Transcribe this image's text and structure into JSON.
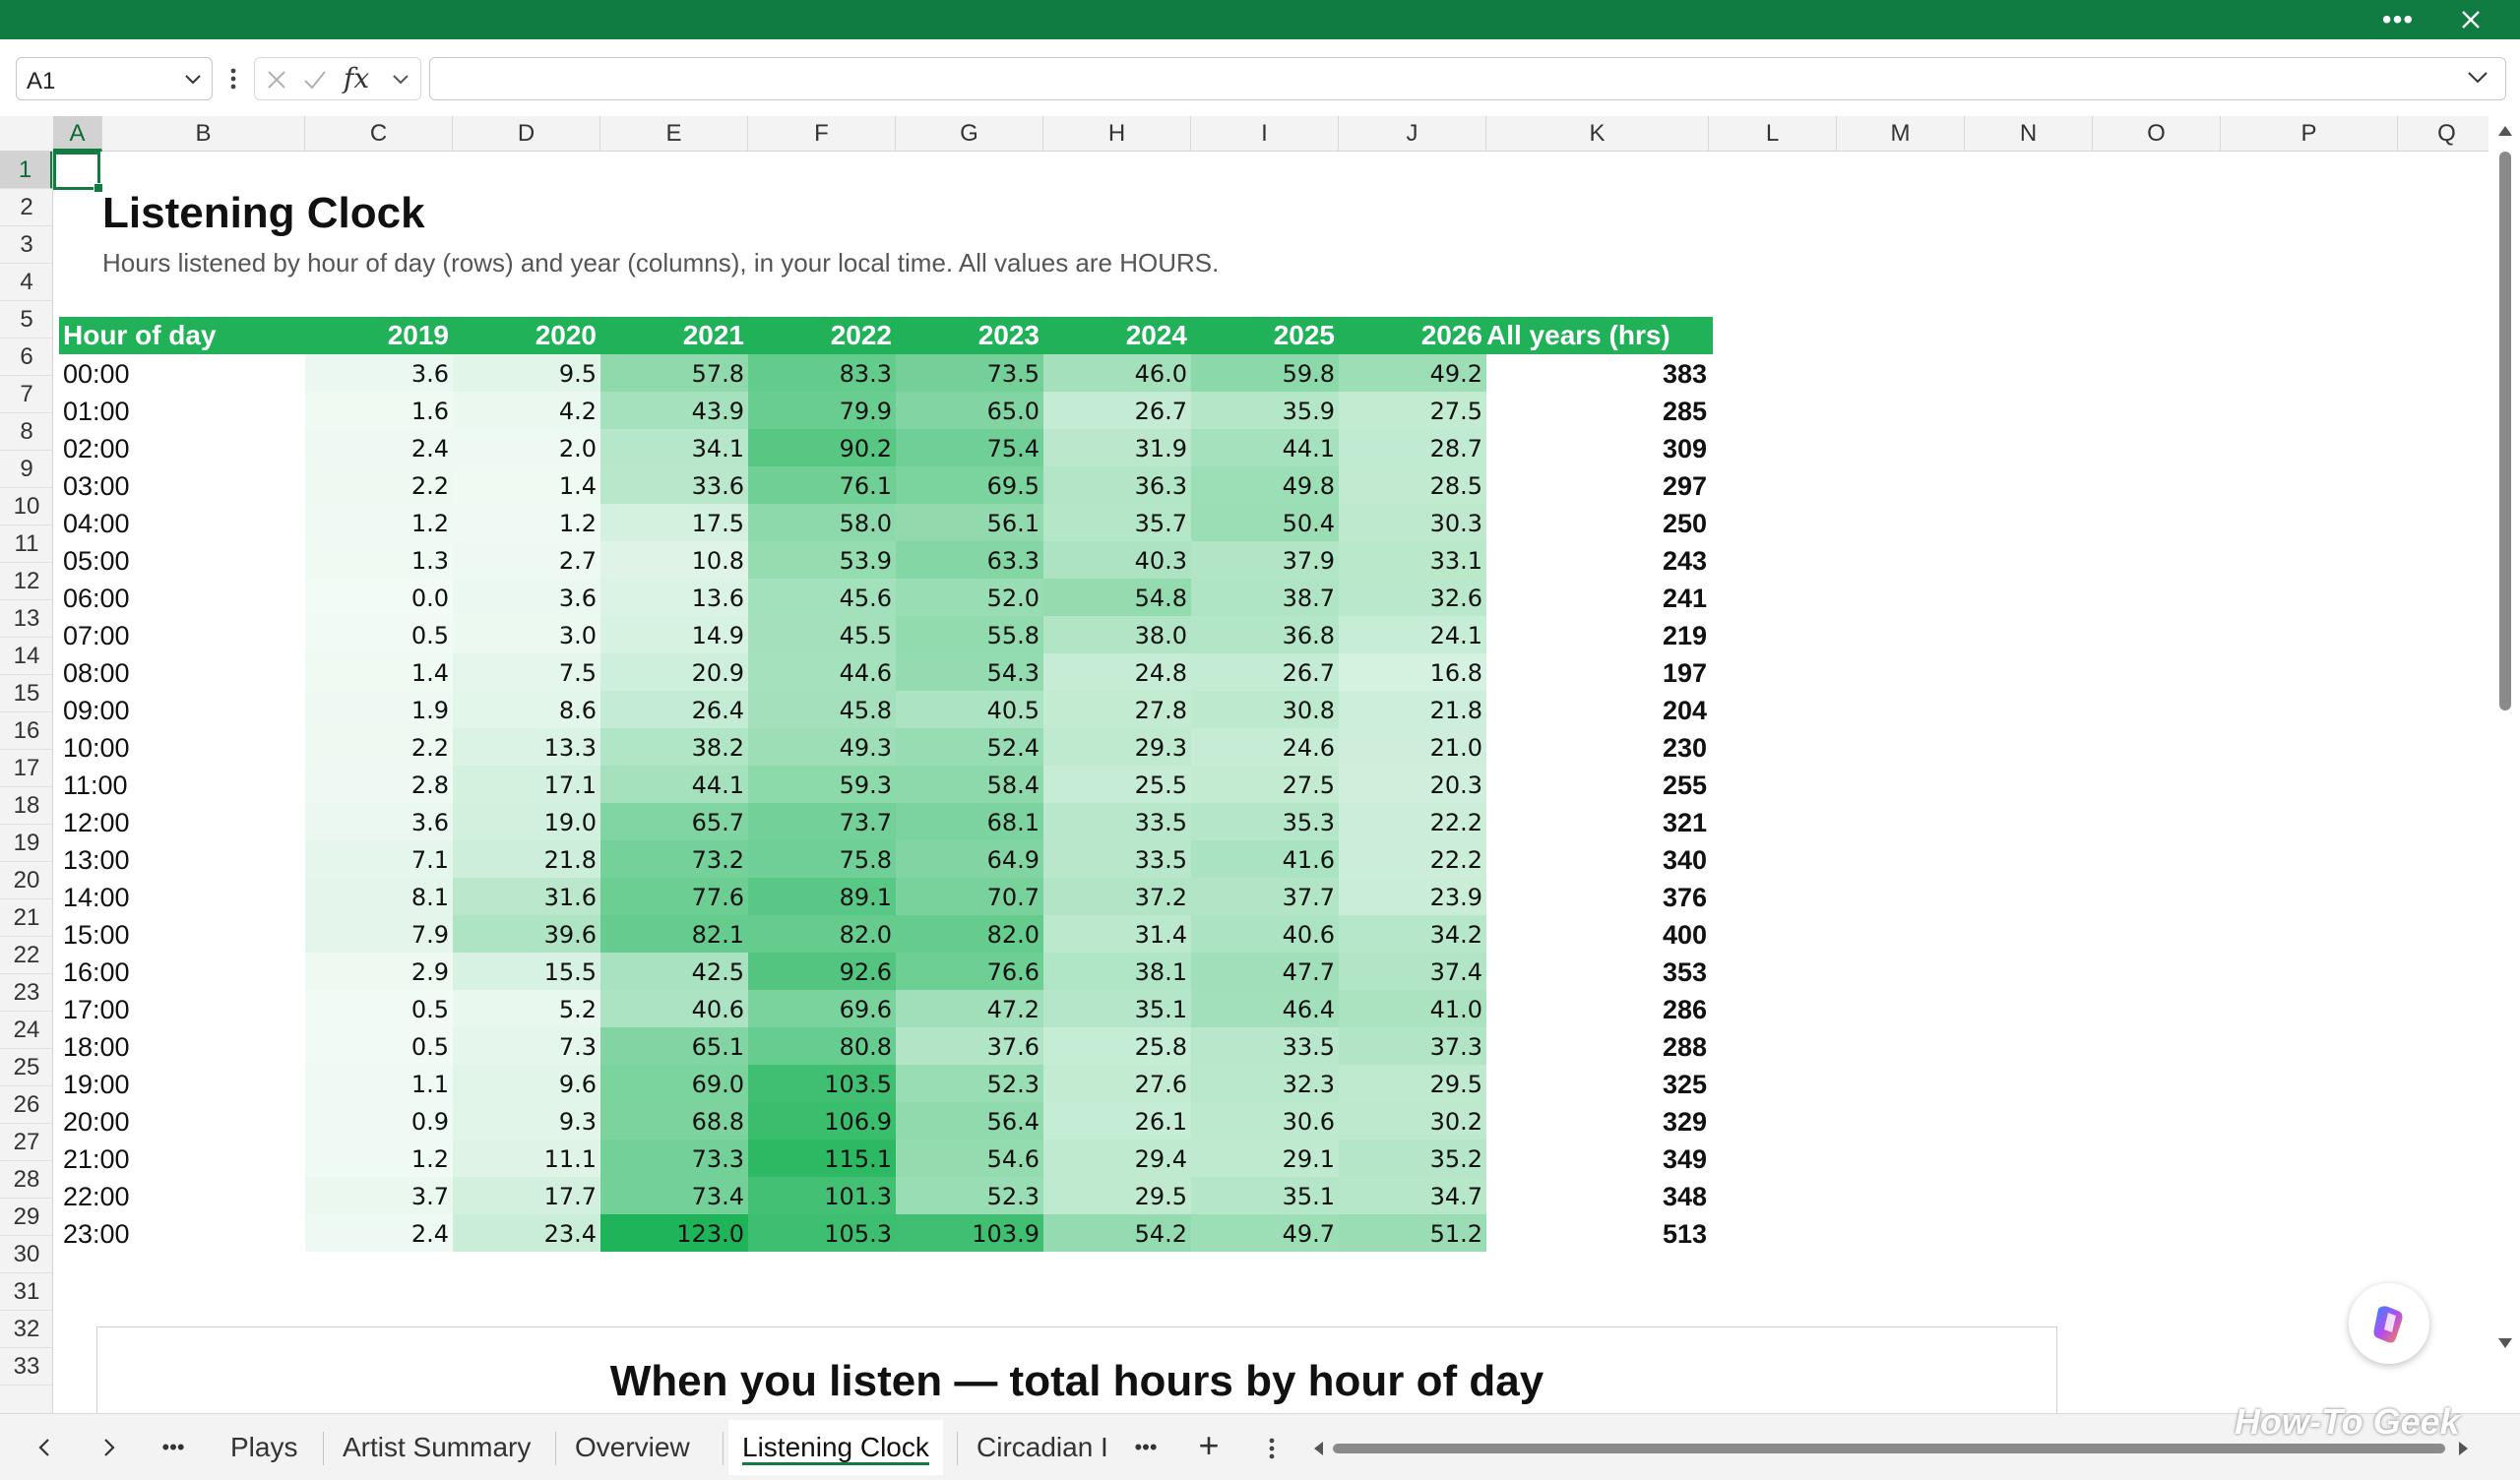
{
  "window": {
    "more_label": "•••"
  },
  "formula_bar": {
    "name_box": "A1",
    "fx_label": "fx",
    "formula": ""
  },
  "columns": [
    "A",
    "B",
    "C",
    "D",
    "E",
    "F",
    "G",
    "H",
    "I",
    "J",
    "K",
    "L",
    "M",
    "N",
    "O",
    "P",
    "Q"
  ],
  "rows": [
    "1",
    "2",
    "3",
    "4",
    "5",
    "6",
    "7",
    "8",
    "9",
    "10",
    "11",
    "12",
    "13",
    "14",
    "15",
    "16",
    "17",
    "18",
    "19",
    "20",
    "21",
    "22",
    "23",
    "24",
    "25",
    "26",
    "27",
    "28",
    "29",
    "30",
    "31",
    "32",
    "33"
  ],
  "sheet": {
    "title": "Listening Clock",
    "subtitle": "Hours listened by hour of day (rows) and year (columns), in your local time. All values are HOURS.",
    "headers": [
      "Hour of day",
      "2019",
      "2020",
      "2021",
      "2022",
      "2023",
      "2024",
      "2025",
      "2026",
      "All years (hrs)"
    ],
    "hours": [
      "00:00",
      "01:00",
      "02:00",
      "03:00",
      "04:00",
      "05:00",
      "06:00",
      "07:00",
      "08:00",
      "09:00",
      "10:00",
      "11:00",
      "12:00",
      "13:00",
      "14:00",
      "15:00",
      "16:00",
      "17:00",
      "18:00",
      "19:00",
      "20:00",
      "21:00",
      "22:00",
      "23:00"
    ],
    "values": [
      [
        "3.6",
        "9.5",
        "57.8",
        "83.3",
        "73.5",
        "46.0",
        "59.8",
        "49.2"
      ],
      [
        "1.6",
        "4.2",
        "43.9",
        "79.9",
        "65.0",
        "26.7",
        "35.9",
        "27.5"
      ],
      [
        "2.4",
        "2.0",
        "34.1",
        "90.2",
        "75.4",
        "31.9",
        "44.1",
        "28.7"
      ],
      [
        "2.2",
        "1.4",
        "33.6",
        "76.1",
        "69.5",
        "36.3",
        "49.8",
        "28.5"
      ],
      [
        "1.2",
        "1.2",
        "17.5",
        "58.0",
        "56.1",
        "35.7",
        "50.4",
        "30.3"
      ],
      [
        "1.3",
        "2.7",
        "10.8",
        "53.9",
        "63.3",
        "40.3",
        "37.9",
        "33.1"
      ],
      [
        "0.0",
        "3.6",
        "13.6",
        "45.6",
        "52.0",
        "54.8",
        "38.7",
        "32.6"
      ],
      [
        "0.5",
        "3.0",
        "14.9",
        "45.5",
        "55.8",
        "38.0",
        "36.8",
        "24.1"
      ],
      [
        "1.4",
        "7.5",
        "20.9",
        "44.6",
        "54.3",
        "24.8",
        "26.7",
        "16.8"
      ],
      [
        "1.9",
        "8.6",
        "26.4",
        "45.8",
        "40.5",
        "27.8",
        "30.8",
        "21.8"
      ],
      [
        "2.2",
        "13.3",
        "38.2",
        "49.3",
        "52.4",
        "29.3",
        "24.6",
        "21.0"
      ],
      [
        "2.8",
        "17.1",
        "44.1",
        "59.3",
        "58.4",
        "25.5",
        "27.5",
        "20.3"
      ],
      [
        "3.6",
        "19.0",
        "65.7",
        "73.7",
        "68.1",
        "33.5",
        "35.3",
        "22.2"
      ],
      [
        "7.1",
        "21.8",
        "73.2",
        "75.8",
        "64.9",
        "33.5",
        "41.6",
        "22.2"
      ],
      [
        "8.1",
        "31.6",
        "77.6",
        "89.1",
        "70.7",
        "37.2",
        "37.7",
        "23.9"
      ],
      [
        "7.9",
        "39.6",
        "82.1",
        "82.0",
        "82.0",
        "31.4",
        "40.6",
        "34.2"
      ],
      [
        "2.9",
        "15.5",
        "42.5",
        "92.6",
        "76.6",
        "38.1",
        "47.7",
        "37.4"
      ],
      [
        "0.5",
        "5.2",
        "40.6",
        "69.6",
        "47.2",
        "35.1",
        "46.4",
        "41.0"
      ],
      [
        "0.5",
        "7.3",
        "65.1",
        "80.8",
        "37.6",
        "25.8",
        "33.5",
        "37.3"
      ],
      [
        "1.1",
        "9.6",
        "69.0",
        "103.5",
        "52.3",
        "27.6",
        "32.3",
        "29.5"
      ],
      [
        "0.9",
        "9.3",
        "68.8",
        "106.9",
        "56.4",
        "26.1",
        "30.6",
        "30.2"
      ],
      [
        "1.2",
        "11.1",
        "73.3",
        "115.1",
        "54.6",
        "29.4",
        "29.1",
        "35.2"
      ],
      [
        "3.7",
        "17.7",
        "73.4",
        "101.3",
        "52.3",
        "29.5",
        "35.1",
        "34.7"
      ],
      [
        "2.4",
        "23.4",
        "123.0",
        "105.3",
        "103.9",
        "54.2",
        "49.7",
        "51.2"
      ]
    ],
    "totals": [
      "383",
      "285",
      "309",
      "297",
      "250",
      "243",
      "241",
      "219",
      "197",
      "204",
      "230",
      "255",
      "321",
      "340",
      "376",
      "400",
      "353",
      "286",
      "288",
      "325",
      "329",
      "349",
      "348",
      "513"
    ],
    "heat_scale": {
      "low": "#ffffff",
      "high": "#1fb45a",
      "max": 123.0
    },
    "chart_title": "When you listen — total hours by hour of day"
  },
  "tabs": {
    "items": [
      "Plays",
      "Artist Summary",
      "Overview",
      "Listening Clock",
      "Circadian I"
    ],
    "active": "Listening Clock",
    "more": "•••",
    "add": "+"
  },
  "watermark": "How-To Geek",
  "accent_color": "#107c41"
}
